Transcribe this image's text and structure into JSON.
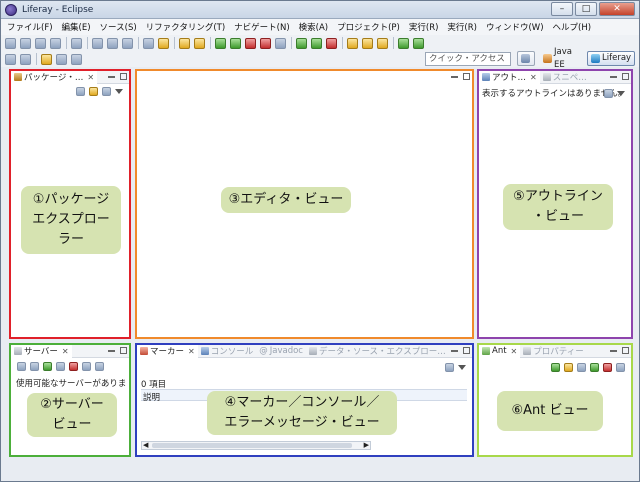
{
  "window": {
    "title": "Liferay - Eclipse",
    "min_label": "–",
    "max_label": "□",
    "close_label": "✕"
  },
  "menubar": {
    "items": [
      "ファイル(F)",
      "編集(E)",
      "ソース(S)",
      "リファクタリング(T)",
      "ナビゲート(N)",
      "検索(A)",
      "プロジェクト(P)",
      "実行(R)",
      "実行(R)",
      "ウィンドウ(W)",
      "ヘルプ(H)"
    ]
  },
  "toolbar": {
    "quick_access_placeholder": "クイック・アクセス",
    "perspectives": {
      "java_ee": "Java EE",
      "liferay": "Liferay"
    }
  },
  "views": {
    "package_explorer": {
      "tab": "パッケージ・…",
      "callout": [
        "①パッケージ",
        "エクスプローラー"
      ]
    },
    "editor": {
      "callout": "③エディタ・ビュー"
    },
    "outline": {
      "tabs": [
        "アウト…",
        "スニペ…"
      ],
      "message": "表示するアウトラインはありません。",
      "callout": [
        "⑤アウトライン",
        "・ビュー"
      ]
    },
    "servers": {
      "tab": "サーバー",
      "message": "使用可能なサーバーがありま",
      "callout": [
        "②サーバー",
        "ビュー"
      ]
    },
    "markers": {
      "tabs": [
        "マーカー",
        "コンソール",
        "Javadoc",
        "データ・ソース・エクスプロー…"
      ],
      "count": "0 項目",
      "column": "説明",
      "callout": [
        "④マーカー／コンソール／",
        "エラーメッセージ・ビュー"
      ]
    },
    "ant": {
      "tabs": [
        "Ant",
        "プロパティー"
      ],
      "callout": "⑥Ant ビュー"
    }
  },
  "colors": {
    "package_explorer_border": "#e0202a",
    "editor_border": "#f08a2c",
    "outline_border": "#8e44ad",
    "servers_border": "#4caf3a",
    "markers_border": "#2f3fbf",
    "ant_border": "#a8d84a",
    "callout_bg": "#d6e3b1"
  }
}
